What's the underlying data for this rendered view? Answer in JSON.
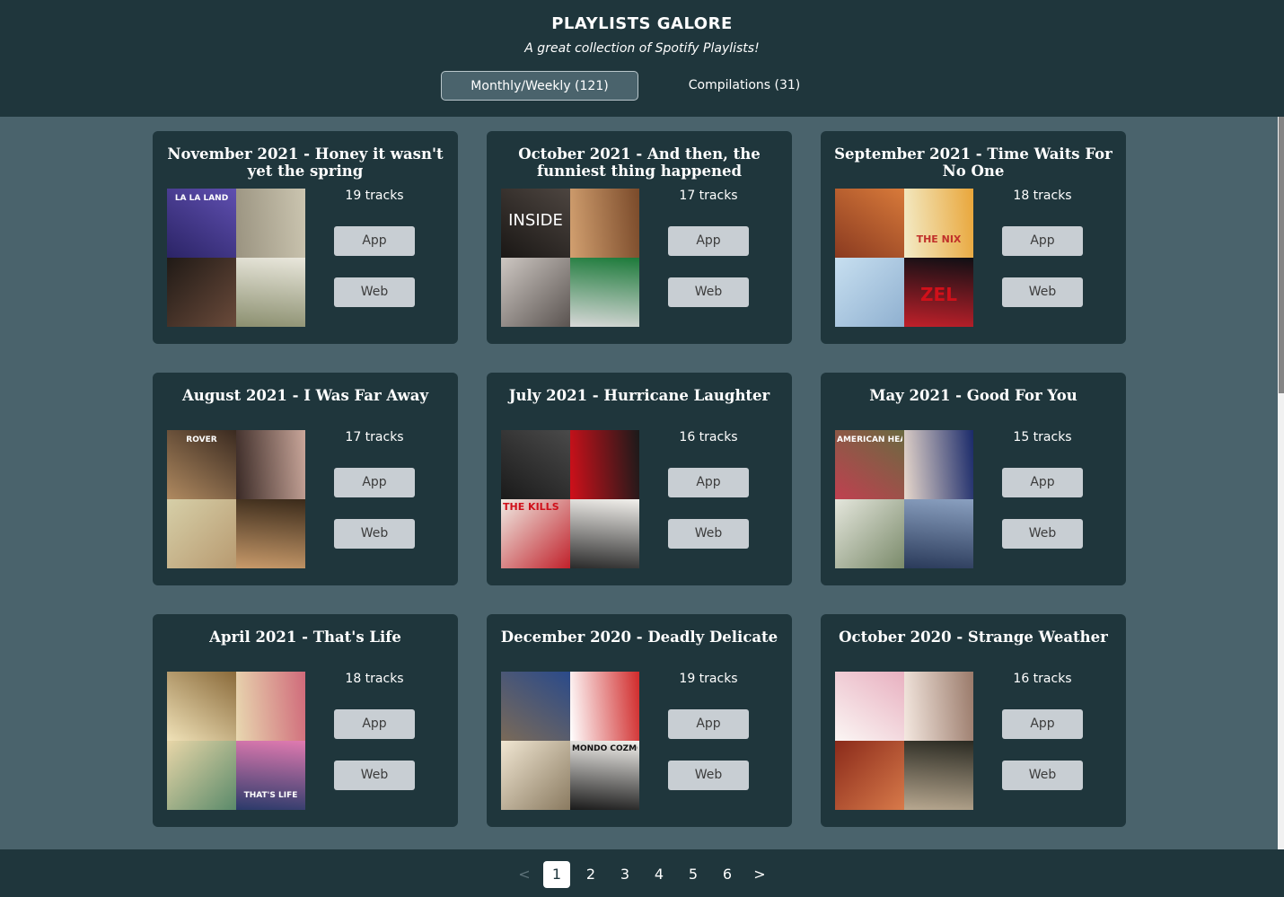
{
  "header": {
    "title": "PLAYLISTS GALORE",
    "subtitle": "A great collection of Spotify Playlists!",
    "tabs": [
      {
        "label": "Monthly/Weekly (121)",
        "active": true
      },
      {
        "label": "Compilations (31)",
        "active": false
      }
    ]
  },
  "buttons": {
    "app_label": "App",
    "web_label": "Web"
  },
  "playlists": [
    {
      "title": "November 2021 - Honey it wasn't yet the spring",
      "tracks": "19 tracks",
      "covers": [
        {
          "colors": [
            "#2b2466",
            "#5f4fb0"
          ],
          "text": "LA LA LAND"
        },
        {
          "colors": [
            "#9a9380",
            "#cbc5b0"
          ],
          "text": ""
        },
        {
          "colors": [
            "#201a16",
            "#6a4a3a"
          ],
          "text": ""
        },
        {
          "colors": [
            "#e9e7dc",
            "#8b8f6f"
          ],
          "text": ""
        }
      ]
    },
    {
      "title": "October 2021 - And then, the funniest thing happened",
      "tracks": "17 tracks",
      "covers": [
        {
          "colors": [
            "#1a1715",
            "#4d4540"
          ],
          "text": "INSIDE"
        },
        {
          "colors": [
            "#d2a070",
            "#7a4a2a"
          ],
          "text": ""
        },
        {
          "colors": [
            "#cdc7c2",
            "#5a5350"
          ],
          "text": ""
        },
        {
          "colors": [
            "#1c7a3a",
            "#d8d8d8"
          ],
          "text": ""
        }
      ]
    },
    {
      "title": "September 2021 - Time Waits For No One",
      "tracks": "18 tracks",
      "covers": [
        {
          "colors": [
            "#8a3a20",
            "#d87a3a"
          ],
          "text": ""
        },
        {
          "colors": [
            "#f3ecc8",
            "#e9a63a"
          ],
          "text": "THE NIX"
        },
        {
          "colors": [
            "#c7dff0",
            "#8fb0d0"
          ],
          "text": ""
        },
        {
          "colors": [
            "#0f0f14",
            "#c0202a"
          ],
          "text": "ZEL"
        }
      ]
    },
    {
      "title": "August 2021 - I Was Far Away",
      "tracks": "17 tracks",
      "covers": [
        {
          "colors": [
            "#b08a60",
            "#3a2a20"
          ],
          "text": "ROVER"
        },
        {
          "colors": [
            "#3a2a26",
            "#c9a69a"
          ],
          "text": ""
        },
        {
          "colors": [
            "#d6cfa8",
            "#b89a70"
          ],
          "text": ""
        },
        {
          "colors": [
            "#3a2a1a",
            "#c89a6a"
          ],
          "text": ""
        }
      ]
    },
    {
      "title": "July 2021 - Hurricane Laughter",
      "tracks": "16 tracks",
      "covers": [
        {
          "colors": [
            "#1a1a1a",
            "#4a4a4a"
          ],
          "text": ""
        },
        {
          "colors": [
            "#d0101a",
            "#1a1a1a"
          ],
          "text": ""
        },
        {
          "colors": [
            "#f0ece4",
            "#c0202a"
          ],
          "text": "THE KILLS"
        },
        {
          "colors": [
            "#f2f0ec",
            "#2a2a2a"
          ],
          "text": ""
        }
      ]
    },
    {
      "title": "May 2021 - Good For You",
      "tracks": "15 tracks",
      "covers": [
        {
          "colors": [
            "#c04050",
            "#6a6a40"
          ],
          "text": "AMERICAN HEAD"
        },
        {
          "colors": [
            "#e8d8cc",
            "#1a2a6a"
          ],
          "text": ""
        },
        {
          "colors": [
            "#e4e6dc",
            "#7a8a6a"
          ],
          "text": ""
        },
        {
          "colors": [
            "#8aa0c0",
            "#2a3a5a"
          ],
          "text": ""
        }
      ]
    },
    {
      "title": "April 2021 - That's Life",
      "tracks": "18 tracks",
      "covers": [
        {
          "colors": [
            "#f0e2b8",
            "#8a6a3a"
          ],
          "text": ""
        },
        {
          "colors": [
            "#e8d8b0",
            "#d06a7a"
          ],
          "text": ""
        },
        {
          "colors": [
            "#e8d6a8",
            "#5a8a6a"
          ],
          "text": ""
        },
        {
          "colors": [
            "#e07ab0",
            "#2a3a6a"
          ],
          "text": "THAT'S LIFE"
        }
      ]
    },
    {
      "title": "December 2020 - Deadly Delicate",
      "tracks": "19 tracks",
      "covers": [
        {
          "colors": [
            "#7a6a58",
            "#2a4a8a"
          ],
          "text": ""
        },
        {
          "colors": [
            "#ffffff",
            "#d02a2a"
          ],
          "text": ""
        },
        {
          "colors": [
            "#f0e6d2",
            "#8a7a60"
          ],
          "text": ""
        },
        {
          "colors": [
            "#f4f2ee",
            "#1a1a1a"
          ],
          "text": "MONDO COZMO"
        }
      ]
    },
    {
      "title": "October 2020 - Strange Weather",
      "tracks": "16 tracks",
      "covers": [
        {
          "colors": [
            "#fbf6f4",
            "#e8b0c0"
          ],
          "text": ""
        },
        {
          "colors": [
            "#f4e8e0",
            "#9a7a6a"
          ],
          "text": ""
        },
        {
          "colors": [
            "#8a2a1a",
            "#d87a4a"
          ],
          "text": ""
        },
        {
          "colors": [
            "#2a2a22",
            "#b8a890"
          ],
          "text": ""
        }
      ]
    }
  ],
  "pagination": {
    "prev": "<",
    "pages": [
      "1",
      "2",
      "3",
      "4",
      "5",
      "6"
    ],
    "current": "1",
    "next": ">"
  }
}
